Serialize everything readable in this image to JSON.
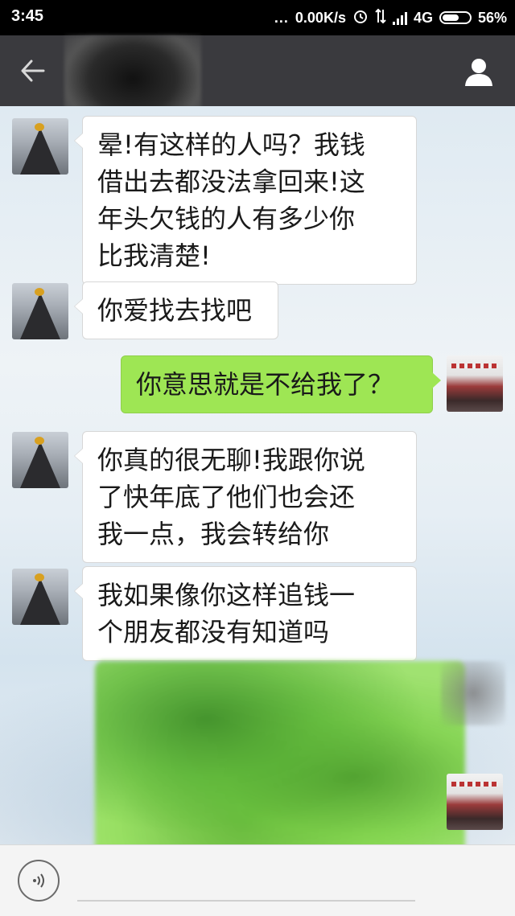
{
  "status_bar": {
    "time": "3:45",
    "dots": "...",
    "network_speed": "0.00K/s",
    "network_type": "4G",
    "battery_percent": "56%",
    "battery_level": 0.56
  },
  "header": {
    "title": "",
    "back_icon": "arrow-left-icon",
    "profile_icon": "person-icon"
  },
  "messages": [
    {
      "side": "left",
      "lines": [
        "晕!有这样的人吗？我钱",
        "借出去都没法拿回来!这",
        "年头欠钱的人有多少你",
        "比我清楚!"
      ]
    },
    {
      "side": "left",
      "lines": [
        "你爱找去找吧"
      ]
    },
    {
      "side": "right",
      "lines": [
        "你意思就是不给我了？"
      ]
    },
    {
      "side": "left",
      "lines": [
        "你真的很无聊!我跟你说",
        "了快年底了他们也会还",
        "我一点，我会转给你"
      ]
    },
    {
      "side": "left",
      "lines": [
        "我如果像你这样追钱一",
        "个朋友都没有知道吗"
      ]
    }
  ],
  "input_bar": {
    "voice_icon": "voice-icon",
    "placeholder": ""
  },
  "colors": {
    "title_bar": "#3a3a3e",
    "bubble_sent": "#9ee654",
    "bubble_received": "#ffffff"
  }
}
